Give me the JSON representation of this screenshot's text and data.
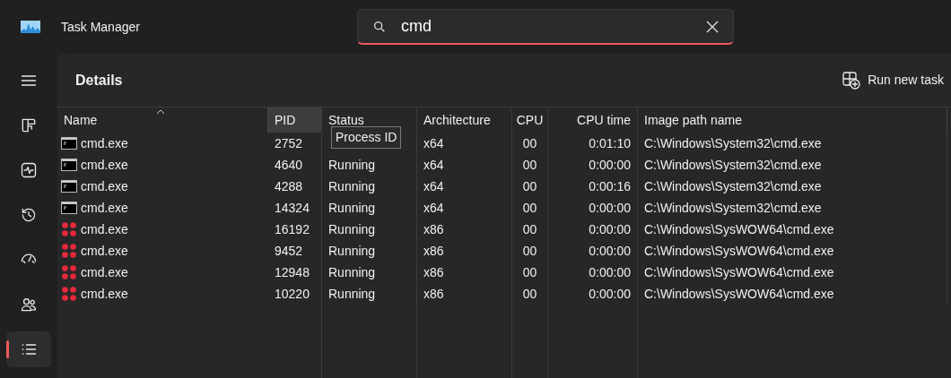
{
  "window": {
    "title": "Task Manager"
  },
  "search": {
    "value": "cmd",
    "focused": true
  },
  "sidebar": {
    "items": [
      {
        "kind": "menu",
        "selected": false
      },
      {
        "kind": "processes",
        "selected": false
      },
      {
        "kind": "performance",
        "selected": false
      },
      {
        "kind": "history",
        "selected": false
      },
      {
        "kind": "startup",
        "selected": false
      },
      {
        "kind": "users",
        "selected": false
      },
      {
        "kind": "details",
        "selected": true
      }
    ]
  },
  "page": {
    "title": "Details",
    "action": "Run new task"
  },
  "table": {
    "columns": [
      {
        "label": "Name",
        "sorted": true,
        "hovered": false
      },
      {
        "label": "PID",
        "sorted": false,
        "hovered": true
      },
      {
        "label": "Status",
        "sorted": false,
        "hovered": false
      },
      {
        "label": "Architecture",
        "sorted": false,
        "hovered": false
      },
      {
        "label": "CPU",
        "sorted": false,
        "hovered": false
      },
      {
        "label": "CPU time",
        "sorted": false,
        "hovered": false
      },
      {
        "label": "Image path name",
        "sorted": false,
        "hovered": false
      }
    ],
    "rows": [
      {
        "kind": "console",
        "cells": [
          "cmd.exe",
          "2752",
          "",
          "x64",
          "00",
          "0:01:10",
          "C:\\Windows\\System32\\cmd.exe"
        ]
      },
      {
        "kind": "console",
        "cells": [
          "cmd.exe",
          "4640",
          "Running",
          "x64",
          "00",
          "0:00:00",
          "C:\\Windows\\System32\\cmd.exe"
        ]
      },
      {
        "kind": "console",
        "cells": [
          "cmd.exe",
          "4288",
          "Running",
          "x64",
          "00",
          "0:00:16",
          "C:\\Windows\\System32\\cmd.exe"
        ]
      },
      {
        "kind": "console",
        "cells": [
          "cmd.exe",
          "14324",
          "Running",
          "x64",
          "00",
          "0:00:00",
          "C:\\Windows\\System32\\cmd.exe"
        ]
      },
      {
        "kind": "dots",
        "cells": [
          "cmd.exe",
          "16192",
          "Running",
          "x86",
          "00",
          "0:00:00",
          "C:\\Windows\\SysWOW64\\cmd.exe"
        ]
      },
      {
        "kind": "dots",
        "cells": [
          "cmd.exe",
          "9452",
          "Running",
          "x86",
          "00",
          "0:00:00",
          "C:\\Windows\\SysWOW64\\cmd.exe"
        ]
      },
      {
        "kind": "dots",
        "cells": [
          "cmd.exe",
          "12948",
          "Running",
          "x86",
          "00",
          "0:00:00",
          "C:\\Windows\\SysWOW64\\cmd.exe"
        ]
      },
      {
        "kind": "dots",
        "cells": [
          "cmd.exe",
          "10220",
          "Running",
          "x86",
          "00",
          "0:00:00",
          "C:\\Windows\\SysWOW64\\cmd.exe"
        ]
      }
    ]
  },
  "tooltip": {
    "text": "Process ID"
  }
}
